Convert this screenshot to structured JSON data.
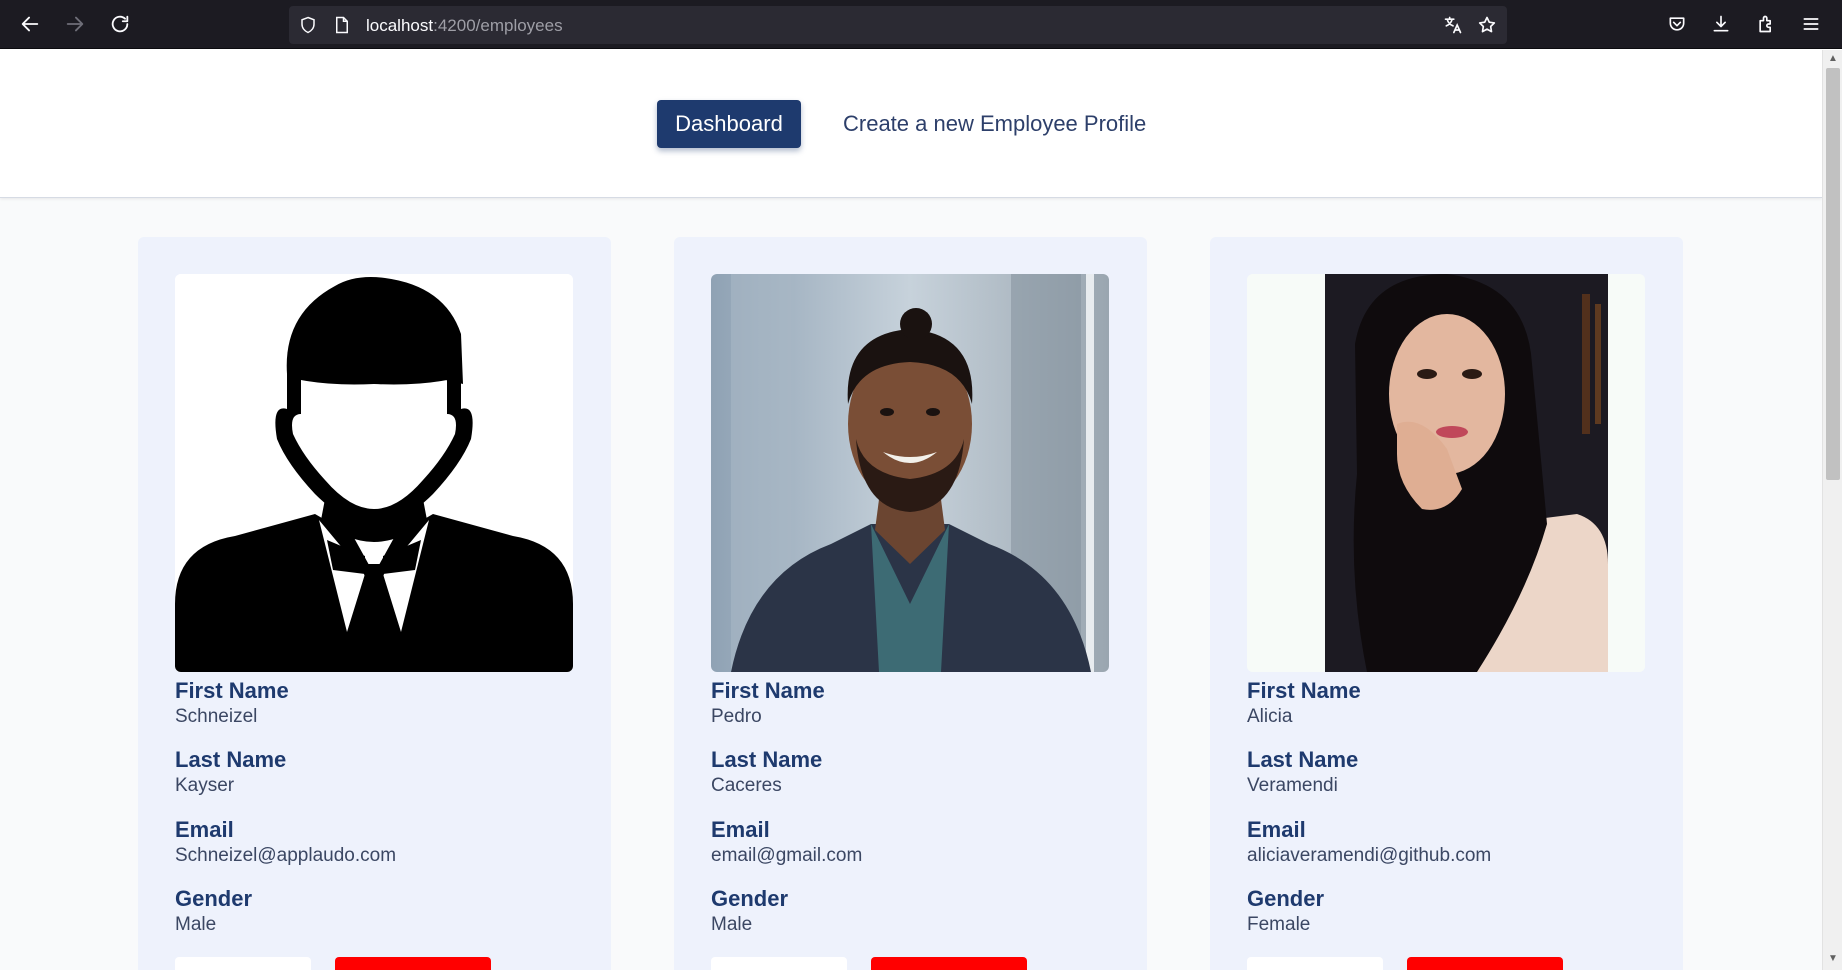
{
  "browser": {
    "url_host": "localhost",
    "url_path": ":4200/employees"
  },
  "header": {
    "dashboard_label": "Dashboard",
    "create_label": "Create a new Employee Profile"
  },
  "labels": {
    "first_name": "First Name",
    "last_name": "Last Name",
    "email": "Email",
    "gender": "Gender"
  },
  "employees": [
    {
      "first_name": "Schneizel",
      "last_name": "Kayser",
      "email": "Schneizel@applaudo.com",
      "gender": "Male",
      "photo": "default-avatar"
    },
    {
      "first_name": "Pedro",
      "last_name": "Caceres",
      "email": "email@gmail.com",
      "gender": "Male",
      "photo": "man-portrait"
    },
    {
      "first_name": "Alicia",
      "last_name": "Veramendi",
      "email": "aliciaveramendi@github.com",
      "gender": "Female",
      "photo": "woman-portrait"
    }
  ],
  "colors": {
    "primary": "#1e3a6e",
    "card_bg": "#eef2fc",
    "delete": "#ff0000"
  }
}
